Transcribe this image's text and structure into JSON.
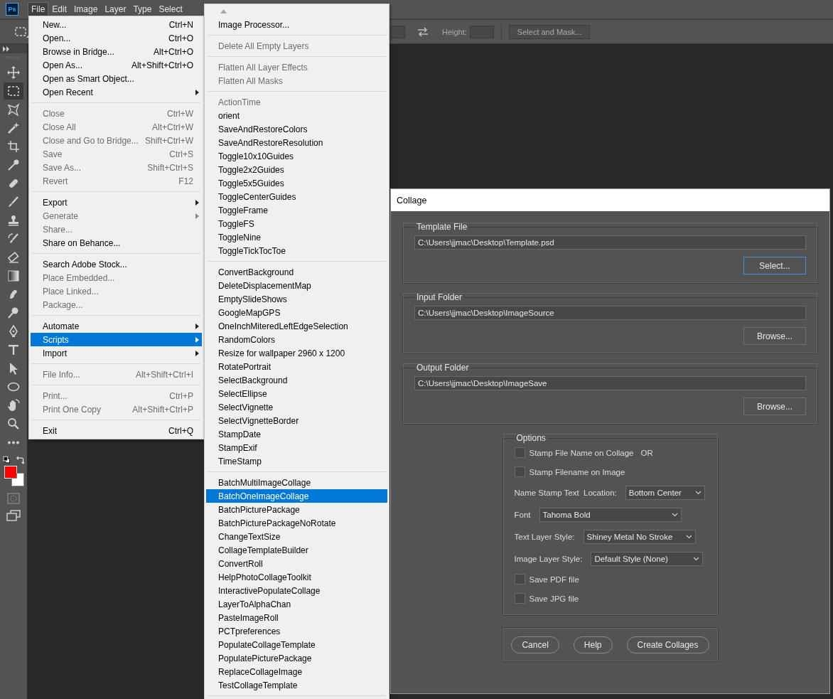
{
  "app_logo": "Ps",
  "menubar": [
    {
      "label": "File",
      "selected": true
    },
    {
      "label": "Edit",
      "selected": false
    },
    {
      "label": "Image",
      "selected": false
    },
    {
      "label": "Layer",
      "selected": false
    },
    {
      "label": "Type",
      "selected": false
    },
    {
      "label": "Select",
      "selected": false
    }
  ],
  "options_bar": {
    "height_label": "Height:",
    "mask_button": "Select and Mask..."
  },
  "tools": [
    {
      "kind": "move",
      "selected": false
    },
    {
      "kind": "marquee",
      "selected": true
    },
    {
      "kind": "lasso",
      "selected": false
    },
    {
      "kind": "wand",
      "selected": false
    },
    {
      "kind": "crop",
      "selected": false
    },
    {
      "kind": "eyedropper",
      "selected": false
    },
    {
      "kind": "healing",
      "selected": false
    },
    {
      "kind": "brush",
      "selected": false
    },
    {
      "kind": "stamp",
      "selected": false
    },
    {
      "kind": "history",
      "selected": false
    },
    {
      "kind": "eraser",
      "selected": false
    },
    {
      "kind": "gradient",
      "selected": false
    },
    {
      "kind": "smudge",
      "selected": false
    },
    {
      "kind": "dodge",
      "selected": false
    },
    {
      "kind": "pen",
      "selected": false
    },
    {
      "kind": "type",
      "selected": false
    },
    {
      "kind": "pointer",
      "selected": false
    },
    {
      "kind": "ellipse",
      "selected": false
    },
    {
      "kind": "hand",
      "selected": false
    },
    {
      "kind": "zoom",
      "selected": false
    },
    {
      "kind": "more",
      "selected": false
    }
  ],
  "color_swatches": [
    {
      "kind": "foreground",
      "color": "#ff0000"
    },
    {
      "kind": "background",
      "color": "#ffffff"
    }
  ],
  "file_menu": {
    "groups": [
      [
        {
          "label": "New...",
          "shortcut": "Ctrl+N",
          "disabled": false,
          "submenu": false,
          "selected": false
        },
        {
          "label": "Open...",
          "shortcut": "Ctrl+O",
          "disabled": false,
          "submenu": false,
          "selected": false
        },
        {
          "label": "Browse in Bridge...",
          "shortcut": "Alt+Ctrl+O",
          "disabled": false,
          "submenu": false,
          "selected": false
        },
        {
          "label": "Open As...",
          "shortcut": "Alt+Shift+Ctrl+O",
          "disabled": false,
          "submenu": false,
          "selected": false
        },
        {
          "label": "Open as Smart Object...",
          "disabled": false,
          "submenu": false,
          "selected": false
        },
        {
          "label": "Open Recent",
          "disabled": false,
          "submenu": true,
          "selected": false
        }
      ],
      [
        {
          "label": "Close",
          "shortcut": "Ctrl+W",
          "disabled": true,
          "submenu": false,
          "selected": false
        },
        {
          "label": "Close All",
          "shortcut": "Alt+Ctrl+W",
          "disabled": true,
          "submenu": false,
          "selected": false
        },
        {
          "label": "Close and Go to Bridge...",
          "shortcut": "Shift+Ctrl+W",
          "disabled": true,
          "submenu": false,
          "selected": false
        },
        {
          "label": "Save",
          "shortcut": "Ctrl+S",
          "disabled": true,
          "submenu": false,
          "selected": false
        },
        {
          "label": "Save As...",
          "shortcut": "Shift+Ctrl+S",
          "disabled": true,
          "submenu": false,
          "selected": false
        },
        {
          "label": "Revert",
          "shortcut": "F12",
          "disabled": true,
          "submenu": false,
          "selected": false
        }
      ],
      [
        {
          "label": "Export",
          "disabled": false,
          "submenu": true,
          "selected": false
        },
        {
          "label": "Generate",
          "disabled": true,
          "submenu": true,
          "selected": false
        },
        {
          "label": "Share...",
          "disabled": true,
          "submenu": false,
          "selected": false
        },
        {
          "label": "Share on Behance...",
          "disabled": false,
          "submenu": false,
          "selected": false
        }
      ],
      [
        {
          "label": "Search Adobe Stock...",
          "disabled": false,
          "submenu": false,
          "selected": false
        },
        {
          "label": "Place Embedded...",
          "disabled": true,
          "submenu": false,
          "selected": false
        },
        {
          "label": "Place Linked...",
          "disabled": true,
          "submenu": false,
          "selected": false
        },
        {
          "label": "Package...",
          "disabled": true,
          "submenu": false,
          "selected": false
        }
      ],
      [
        {
          "label": "Automate",
          "disabled": false,
          "submenu": true,
          "selected": false
        },
        {
          "label": "Scripts",
          "disabled": false,
          "submenu": true,
          "selected": true
        },
        {
          "label": "Import",
          "disabled": false,
          "submenu": true,
          "selected": false
        }
      ],
      [
        {
          "label": "File Info...",
          "shortcut": "Alt+Shift+Ctrl+I",
          "disabled": true,
          "submenu": false,
          "selected": false
        }
      ],
      [
        {
          "label": "Print...",
          "shortcut": "Ctrl+P",
          "disabled": true,
          "submenu": false,
          "selected": false
        },
        {
          "label": "Print One Copy",
          "shortcut": "Alt+Shift+Ctrl+P",
          "disabled": true,
          "submenu": false,
          "selected": false
        }
      ],
      [
        {
          "label": "Exit",
          "shortcut": "Ctrl+Q",
          "disabled": false,
          "submenu": false,
          "selected": false
        }
      ]
    ]
  },
  "scripts_menu": {
    "more_below": true,
    "groups": [
      [
        {
          "label": "Image Processor...",
          "disabled": false,
          "selected": false
        }
      ],
      [
        {
          "label": "Delete All Empty Layers",
          "disabled": true,
          "selected": false
        }
      ],
      [
        {
          "label": "Flatten All Layer Effects",
          "disabled": true,
          "selected": false
        },
        {
          "label": "Flatten All Masks",
          "disabled": true,
          "selected": false
        }
      ],
      [
        {
          "label": "ActionTime",
          "disabled": true,
          "selected": false
        },
        {
          "label": "orient",
          "disabled": false,
          "selected": false
        },
        {
          "label": "SaveAndRestoreColors",
          "disabled": false,
          "selected": false
        },
        {
          "label": "SaveAndRestoreResolution",
          "disabled": false,
          "selected": false
        },
        {
          "label": "Toggle10x10Guides",
          "disabled": false,
          "selected": false
        },
        {
          "label": "Toggle2x2Guides",
          "disabled": false,
          "selected": false
        },
        {
          "label": "Toggle5x5Guides",
          "disabled": false,
          "selected": false
        },
        {
          "label": "ToggleCenterGuides",
          "disabled": false,
          "selected": false
        },
        {
          "label": "ToggleFrame",
          "disabled": false,
          "selected": false
        },
        {
          "label": "ToggleFS",
          "disabled": false,
          "selected": false
        },
        {
          "label": "ToggleNine",
          "disabled": false,
          "selected": false
        },
        {
          "label": "ToggleTickTocToe",
          "disabled": false,
          "selected": false
        }
      ],
      [
        {
          "label": "ConvertBackground",
          "disabled": false,
          "selected": false
        },
        {
          "label": "DeleteDisplacementMap",
          "disabled": false,
          "selected": false
        },
        {
          "label": "EmptySlideShows",
          "disabled": false,
          "selected": false
        },
        {
          "label": "GoogleMapGPS",
          "disabled": false,
          "selected": false
        },
        {
          "label": "OneInchMiteredLeftEdgeSelection",
          "disabled": false,
          "selected": false
        },
        {
          "label": "RandomColors",
          "disabled": false,
          "selected": false
        },
        {
          "label": "Resize for wallpaper 2960 x 1200",
          "disabled": false,
          "selected": false
        },
        {
          "label": "RotatePortrait",
          "disabled": false,
          "selected": false
        },
        {
          "label": "SelectBackground",
          "disabled": false,
          "selected": false
        },
        {
          "label": "SelectEllipse",
          "disabled": false,
          "selected": false
        },
        {
          "label": "SelectVignette",
          "disabled": false,
          "selected": false
        },
        {
          "label": "SelectVignetteBorder",
          "disabled": false,
          "selected": false
        },
        {
          "label": "StampDate",
          "disabled": false,
          "selected": false
        },
        {
          "label": "StampExif",
          "disabled": false,
          "selected": false
        },
        {
          "label": "TimeStamp",
          "disabled": false,
          "selected": false
        }
      ],
      [
        {
          "label": "BatchMultiImageCollage",
          "disabled": false,
          "selected": false
        },
        {
          "label": "BatchOneImageCollage",
          "disabled": false,
          "selected": true
        },
        {
          "label": "BatchPicturePackage",
          "disabled": false,
          "selected": false
        },
        {
          "label": "BatchPicturePackageNoRotate",
          "disabled": false,
          "selected": false
        },
        {
          "label": "ChangeTextSize",
          "disabled": false,
          "selected": false
        },
        {
          "label": "CollageTemplateBuilder",
          "disabled": false,
          "selected": false
        },
        {
          "label": "ConvertRoll",
          "disabled": false,
          "selected": false
        },
        {
          "label": "HelpPhotoCollageToolkit",
          "disabled": false,
          "selected": false
        },
        {
          "label": "InteractivePopulateCollage",
          "disabled": false,
          "selected": false
        },
        {
          "label": "LayerToAlphaChan",
          "disabled": false,
          "selected": false
        },
        {
          "label": "PasteImageRoll",
          "disabled": false,
          "selected": false
        },
        {
          "label": "PCTpreferences",
          "disabled": false,
          "selected": false
        },
        {
          "label": "PopulateCollageTemplate",
          "disabled": false,
          "selected": false
        },
        {
          "label": "PopulatePicturePackage",
          "disabled": false,
          "selected": false
        },
        {
          "label": "ReplaceCollageImage",
          "disabled": false,
          "selected": false
        },
        {
          "label": "TestCollageTemplate",
          "disabled": false,
          "selected": false
        }
      ]
    ]
  },
  "dialog": {
    "title": "Collage",
    "file_panels": [
      {
        "title": "Template File",
        "path": "C:\\Users\\jjmac\\Desktop\\Template.psd",
        "button": "Select...",
        "focused": true
      },
      {
        "title": "Input Folder",
        "path": "C:\\Users\\jjmac\\Desktop\\ImageSource",
        "button": "Browse...",
        "focused": false
      },
      {
        "title": "Output Folder",
        "path": "C:\\Users\\jjmac\\Desktop\\ImageSave",
        "button": "Browse...",
        "focused": false
      }
    ],
    "options": {
      "title": "Options",
      "rows": [
        {
          "kind": "checkbox",
          "label": "Stamp File Name on Collage",
          "checked": false,
          "note": "OR"
        },
        {
          "kind": "checkbox",
          "label": "Stamp Filename on Image",
          "checked": false
        },
        {
          "kind": "select",
          "label": "Name Stamp Text  Location:",
          "value": "Bottom Center"
        },
        {
          "kind": "select",
          "label": "Font",
          "value": "Tahoma Bold"
        },
        {
          "kind": "select",
          "label": "Text Layer Style:",
          "value": "Shiney Metal No Stroke"
        },
        {
          "kind": "select",
          "label": "Image Layer Style:",
          "value": "Default Style (None)"
        },
        {
          "kind": "checkbox",
          "label": "Save PDF file",
          "checked": false
        },
        {
          "kind": "checkbox",
          "label": "Save JPG file",
          "checked": false
        }
      ]
    },
    "buttons": [
      "Cancel",
      "Help",
      "Create Collages"
    ]
  }
}
